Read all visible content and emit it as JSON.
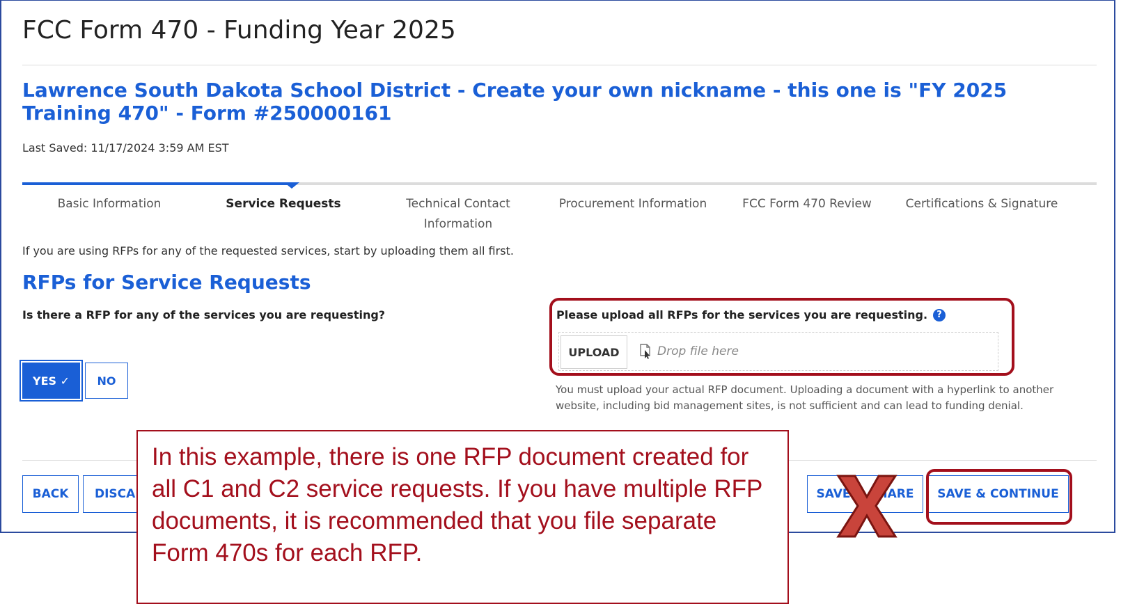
{
  "header": {
    "page_title": "FCC Form 470 - Funding Year 2025",
    "form_title": "Lawrence South Dakota School District - Create your own nickname - this one is \"FY 2025 Training 470\" - Form #250000161",
    "last_saved": "Last Saved: 11/17/2024 3:59 AM EST"
  },
  "steps": [
    {
      "label": "Basic Information",
      "active": false
    },
    {
      "label": "Service Requests",
      "active": true
    },
    {
      "label": "Technical Contact Information",
      "active": false
    },
    {
      "label": "Procurement Information",
      "active": false
    },
    {
      "label": "FCC Form 470 Review",
      "active": false
    },
    {
      "label": "Certifications & Signature",
      "active": false
    }
  ],
  "progress": {
    "current_step": 2,
    "total_steps": 6
  },
  "content": {
    "intro": "If you are using RFPs for any of the requested services, start by uploading them all first.",
    "section_title": "RFPs for Service Requests",
    "question": "Is there a RFP for any of the services you are requesting?",
    "yes_label": "YES ✓",
    "no_label": "NO",
    "selected": "YES",
    "upload_label": "Please upload all RFPs for the services you are requesting.",
    "upload_button": "UPLOAD",
    "drop_placeholder": "Drop file here",
    "upload_note": "You must upload your actual RFP document. Uploading a document with a hyperlink to another website, including bid management sites, is not sufficient and can lead to funding denial."
  },
  "footer": {
    "back": "BACK",
    "discard": "DISCARD FORM",
    "save_share": "SAVE & SHARE",
    "save_continue": "SAVE & CONTINUE"
  },
  "annotation": {
    "callout": "In this example, there is one RFP document created for all C1 and C2 service requests.  If you have multiple RFP documents, it is recommended that you file separate Form 470s for each RFP.",
    "highlight_color": "#a30f1c",
    "x_mark_target": "SAVE & SHARE"
  },
  "colors": {
    "accent": "#1a5fd6",
    "annotation": "#a30f1c"
  }
}
